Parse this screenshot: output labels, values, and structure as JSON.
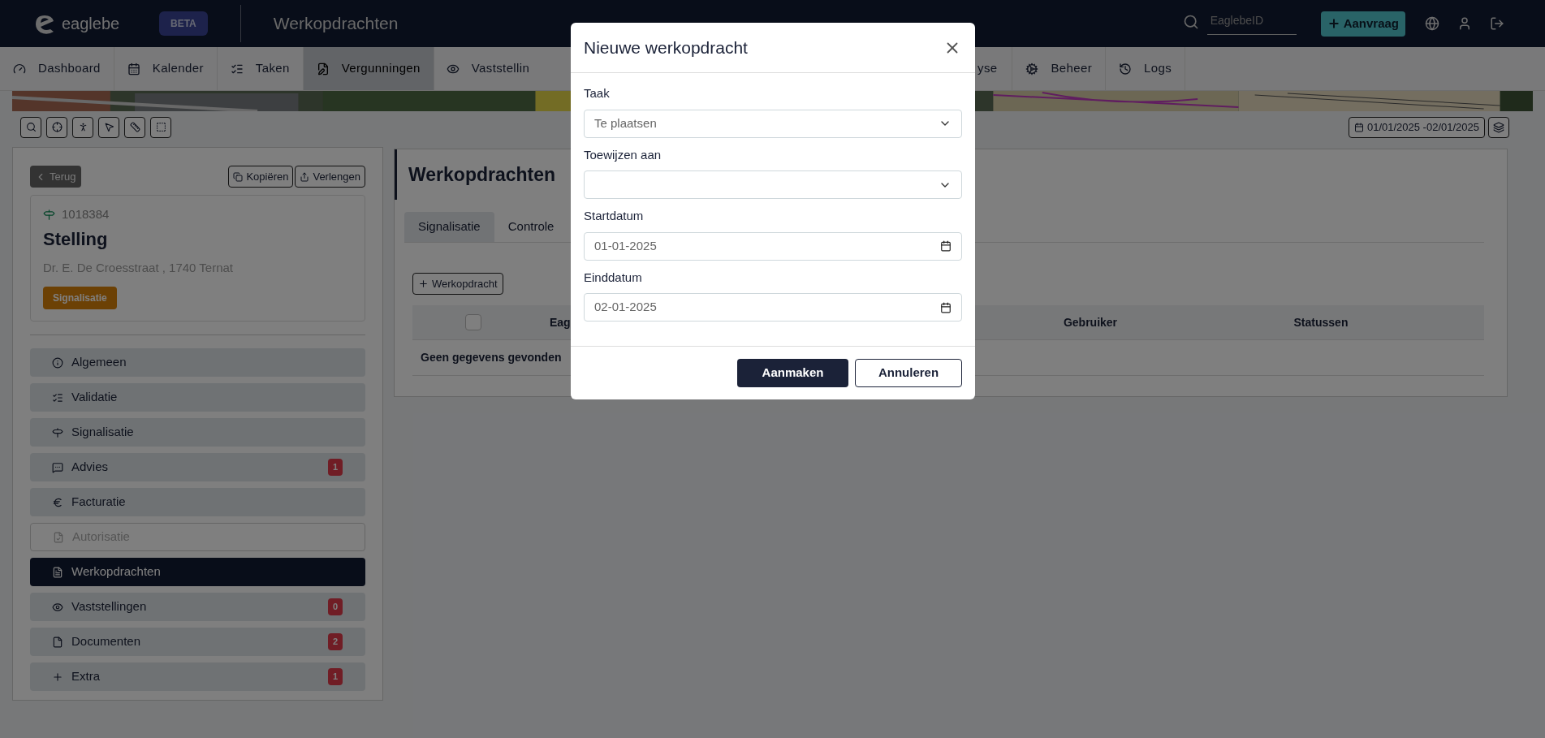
{
  "header": {
    "logo": "eaglebe",
    "badge": "BETA",
    "title": "Werkopdrachten",
    "search": {
      "placeholder": "EaglebeID"
    },
    "request_button": "Aanvraag"
  },
  "nav": [
    {
      "label": "Dashboard",
      "selected": false
    },
    {
      "label": "Kalender",
      "selected": false
    },
    {
      "label": "Taken",
      "selected": false
    },
    {
      "label": "Vergunningen",
      "selected": true
    },
    {
      "label": "Vaststellin",
      "selected": false
    },
    {
      "label": "yse",
      "selected": false
    },
    {
      "label": "Beheer",
      "selected": false
    },
    {
      "label": "Logs",
      "selected": false
    }
  ],
  "map_toolbar": {
    "date_range": "01/01/2025 -02/01/2025"
  },
  "record": {
    "back": "Terug",
    "copy": "Kopiëren",
    "extend": "Verlengen",
    "number": "1018384",
    "title": "Stelling",
    "address": "Dr. E. De Croesstraat , 1740 Ternat",
    "tag": "Signalisatie"
  },
  "sidebar": {
    "items": [
      {
        "label": "Algemeen",
        "selected": false,
        "disabled": false
      },
      {
        "label": "Validatie",
        "selected": false,
        "disabled": false
      },
      {
        "label": "Signalisatie",
        "selected": false,
        "disabled": false
      },
      {
        "label": "Advies",
        "selected": false,
        "disabled": false,
        "badge": "1"
      },
      {
        "label": "Facturatie",
        "selected": false,
        "disabled": false
      },
      {
        "label": "Autorisatie",
        "selected": false,
        "disabled": true
      },
      {
        "label": "Werkopdrachten",
        "selected": true,
        "disabled": false
      },
      {
        "label": "Vaststellingen",
        "selected": false,
        "disabled": false,
        "badge": "0"
      },
      {
        "label": "Documenten",
        "selected": false,
        "disabled": false,
        "badge": "2"
      },
      {
        "label": "Extra",
        "selected": false,
        "disabled": false,
        "badge": "1"
      }
    ]
  },
  "content": {
    "title": "Werkopdrachten",
    "tabs": [
      {
        "label": "Signalisatie",
        "selected": true
      },
      {
        "label": "Controle",
        "selected": false
      }
    ],
    "add_button": "Werkopdracht",
    "table": {
      "select_all": {
        "checked": false
      },
      "columns": [
        "Eag",
        "Gebruiker",
        "Statussen"
      ],
      "empty": "Geen gegevens gevonden"
    }
  },
  "modal": {
    "title": "Nieuwe werkopdracht",
    "fields": [
      {
        "kind": "select",
        "label": "Taak",
        "value": "Te plaatsen"
      },
      {
        "kind": "select",
        "label": "Toewijzen aan"
      },
      {
        "kind": "date",
        "label": "Startdatum",
        "value": "01-01-2025"
      },
      {
        "kind": "date",
        "label": "Einddatum",
        "value": "02-01-2025"
      }
    ],
    "buttons": [
      {
        "label": "Aanmaken",
        "kind": "primary"
      },
      {
        "label": "Annuleren",
        "kind": "secondary"
      }
    ]
  }
}
